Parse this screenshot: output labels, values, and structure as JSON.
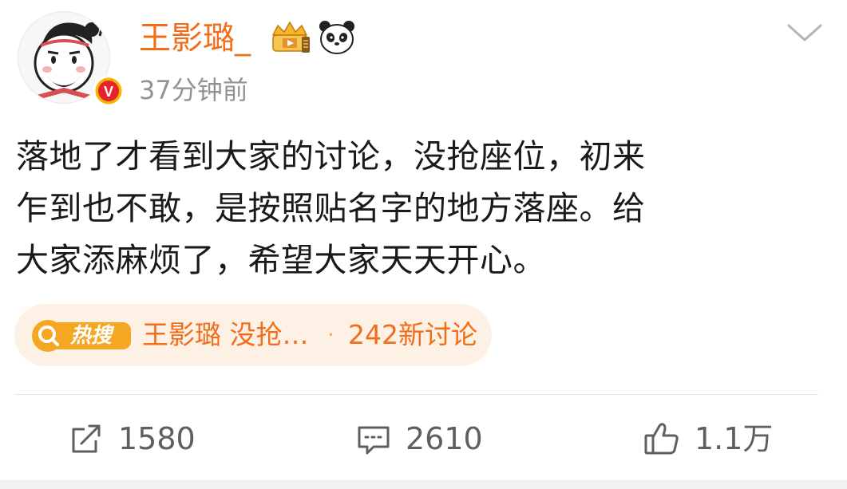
{
  "post": {
    "author": {
      "name": "王影璐_",
      "timestamp": "37分钟前",
      "verified_badge_letter": "V",
      "icons": [
        "vip-crown-badge",
        "panda-icon"
      ]
    },
    "content": {
      "line1": "落地了才看到大家的讨论，没抢座位，初来",
      "line2": "乍到也不敢，是按照贴名字的地方落座。给",
      "line3": "大家添麻烦了，希望大家天天开心。"
    },
    "hot_search": {
      "tag_label": "热搜",
      "title": "王影璐 没抢…",
      "separator": "·",
      "discussion_count": "242新讨论"
    },
    "actions": {
      "repost_count": "1580",
      "comment_count": "2610",
      "like_count": "1.1万"
    }
  },
  "colors": {
    "accent_orange": "#f26d1a",
    "hot_pill_bg": "#fdf1e6",
    "timestamp_gray": "#939393",
    "body_text": "#1a1a1a",
    "action_gray": "#5f5f5f"
  }
}
